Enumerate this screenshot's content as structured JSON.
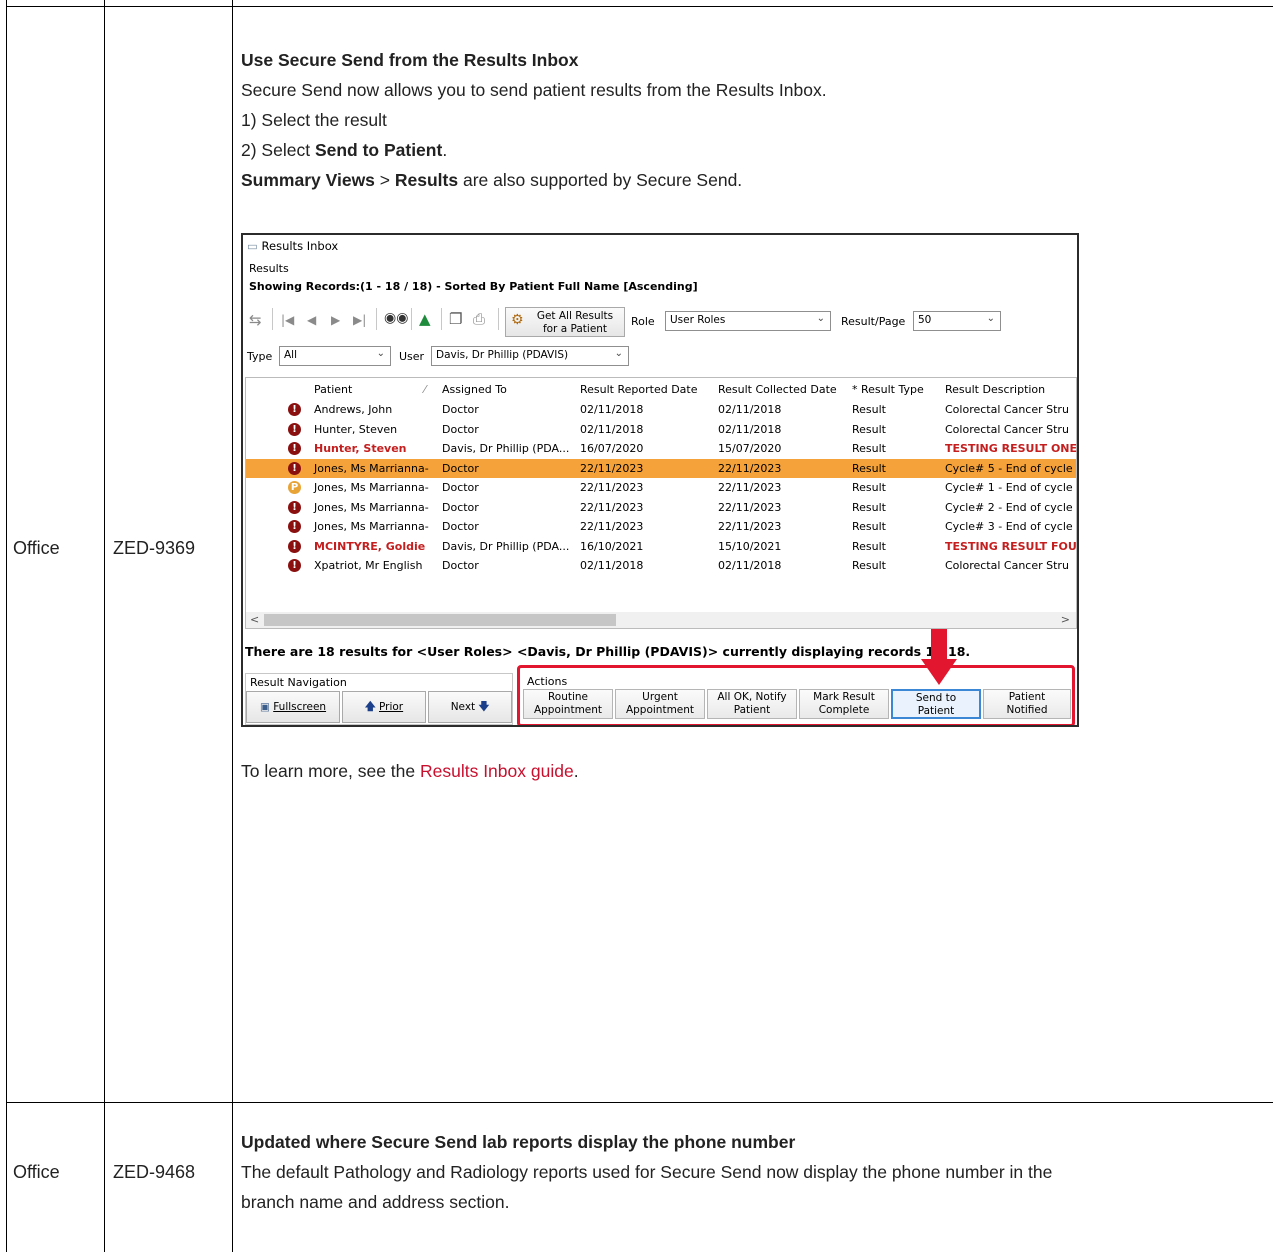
{
  "rows": [
    {
      "product": "Office",
      "ticket": "ZED-9369",
      "heading": "Use Secure Send from the Results Inbox",
      "intro": "Secure Send now allows you to send patient results from the Results Inbox.",
      "step1": "1) Select the result",
      "step2_prefix": "2) Select ",
      "step2_bold": "Send to Patient",
      "step2_suffix": ".",
      "summary_bold1": "Summary Views",
      "summary_sep": " > ",
      "summary_bold2": "Results",
      "summary_suffix": " are also supported by Secure Send.",
      "learn_prefix": "To learn more, see the ",
      "learn_link": "Results Inbox guide",
      "learn_suffix": "."
    },
    {
      "product": "Office",
      "ticket": "ZED-9468",
      "heading": "Updated where Secure Send lab reports display the phone number",
      "body_line1": "The default Pathology and Radiology reports used for Secure Send now display the phone number in the",
      "body_line2": "branch name and address section."
    }
  ],
  "screenshot": {
    "window_title": "Results Inbox",
    "section_label": "Results",
    "showing": "Showing Records:(1 - 18 / 18) - Sorted By Patient Full Name [Ascending]",
    "get_all_line1": "Get All Results",
    "get_all_line2": "for a Patient",
    "role_label": "Role",
    "role_value": "User Roles",
    "result_page_label": "Result/Page",
    "result_page_value": "50",
    "type_label": "Type",
    "type_value": "All",
    "user_label": "User",
    "user_value": "Davis, Dr Phillip (PDAVIS)",
    "columns": [
      "Patient",
      "Assigned To",
      "Result Reported Date",
      "Result Collected Date",
      "* Result Type",
      "Result Description"
    ],
    "table": [
      {
        "patient": "Andrews, John",
        "assigned": "Doctor",
        "reported": "02/11/2018",
        "collected": "02/11/2018",
        "type": "Result",
        "desc": "Colorectal Cancer Stru",
        "style": "normal",
        "icon": "!"
      },
      {
        "patient": "Hunter, Steven",
        "assigned": "Doctor",
        "reported": "02/11/2018",
        "collected": "02/11/2018",
        "type": "Result",
        "desc": "Colorectal Cancer Stru",
        "style": "normal",
        "icon": "!"
      },
      {
        "patient": "Hunter, Steven",
        "assigned": "Davis, Dr Phillip (PDA...",
        "reported": "16/07/2020",
        "collected": "15/07/2020",
        "type": "Result",
        "desc": "TESTING RESULT ONE",
        "style": "red",
        "icon": "!"
      },
      {
        "patient": "Jones, Ms Marrianna-",
        "assigned": "Doctor",
        "reported": "22/11/2023",
        "collected": "22/11/2023",
        "type": "Result",
        "desc": "Cycle# 5 - End of cycle",
        "style": "selected",
        "icon": "!"
      },
      {
        "patient": "Jones, Ms Marrianna-",
        "assigned": "Doctor",
        "reported": "22/11/2023",
        "collected": "22/11/2023",
        "type": "Result",
        "desc": "Cycle# 1 - End of cycle",
        "style": "normal",
        "icon": "P"
      },
      {
        "patient": "Jones, Ms Marrianna-",
        "assigned": "Doctor",
        "reported": "22/11/2023",
        "collected": "22/11/2023",
        "type": "Result",
        "desc": "Cycle# 2 - End of cycle",
        "style": "normal",
        "icon": "!"
      },
      {
        "patient": "Jones, Ms Marrianna-",
        "assigned": "Doctor",
        "reported": "22/11/2023",
        "collected": "22/11/2023",
        "type": "Result",
        "desc": "Cycle# 3 - End of cycle",
        "style": "normal",
        "icon": "!"
      },
      {
        "patient": "MCINTYRE, Goldie",
        "assigned": "Davis, Dr Phillip (PDA...",
        "reported": "16/10/2021",
        "collected": "15/10/2021",
        "type": "Result",
        "desc": "TESTING RESULT FOUI",
        "style": "red",
        "icon": "!"
      },
      {
        "patient": "Xpatriot, Mr English",
        "assigned": "Doctor",
        "reported": "02/11/2018",
        "collected": "02/11/2018",
        "type": "Result",
        "desc": "Colorectal Cancer Stru",
        "style": "normal",
        "icon": "!"
      }
    ],
    "status_text": "There are 18 results for <User Roles> <Davis, Dr Phillip (PDAVIS)> currently displaying records 1 - 18.",
    "nav_group_label": "Result Navigation",
    "fullscreen_label": "Fullscreen",
    "prior_label": "Prior",
    "next_label": "Next",
    "actions_label": "Actions",
    "action_buttons": [
      {
        "l1": "Routine",
        "l2": "Appointment"
      },
      {
        "l1": "Urgent",
        "l2": "Appointment"
      },
      {
        "l1": "All OK, Notify",
        "l2": "Patient"
      },
      {
        "l1": "Mark Result",
        "l2": "Complete"
      },
      {
        "l1": "Send to",
        "l2": "Patient"
      },
      {
        "l1": "Patient",
        "l2": "Notified"
      }
    ],
    "highlight_color": "#e2162f",
    "selected_row_color": "#f6a23b"
  }
}
